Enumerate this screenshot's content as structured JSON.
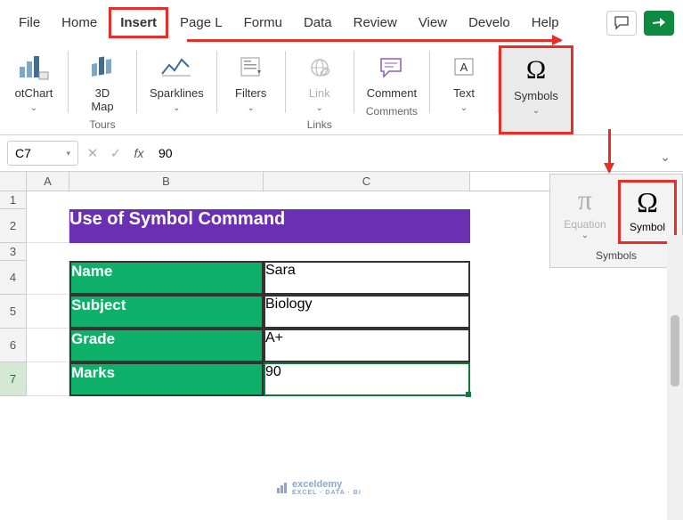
{
  "tabs": {
    "file": "File",
    "home": "Home",
    "insert": "Insert",
    "pagelayout": "Page L",
    "formulas": "Formu",
    "data": "Data",
    "review": "Review",
    "view": "View",
    "developer": "Develo",
    "help": "Help"
  },
  "ribbon": {
    "pivotchart": "otChart",
    "map3d": "3D\nMap",
    "tours_group": "Tours",
    "sparklines": "Sparklines",
    "filters": "Filters",
    "link": "Link",
    "links_group": "Links",
    "comment": "Comment",
    "comments_group": "Comments",
    "text": "Text",
    "symbols": "Symbols"
  },
  "formula_bar": {
    "cell_ref": "C7",
    "value": "90"
  },
  "columns": {
    "A": "A",
    "B": "B",
    "C": "C"
  },
  "rows": {
    "r1": "1",
    "r2": "2",
    "r3": "3",
    "r4": "4",
    "r5": "5",
    "r6": "6",
    "r7": "7"
  },
  "sheet": {
    "title": "Use of Symbol Command",
    "labels": {
      "name": "Name",
      "subject": "Subject",
      "grade": "Grade",
      "marks": "Marks"
    },
    "values": {
      "name": "Sara",
      "subject": "Biology",
      "grade": "A+",
      "marks": "90"
    }
  },
  "symbols_panel": {
    "equation": "Equation",
    "symbol": "Symbol",
    "group": "Symbols"
  },
  "watermark": {
    "brand": "exceldemy",
    "sub": "EXCEL · DATA · BI"
  },
  "glyphs": {
    "pi": "π",
    "omega": "Ω",
    "chevron_down": "⌄",
    "check": "✓",
    "x": "✕",
    "fx": "fx",
    "dropdown": "▾"
  }
}
